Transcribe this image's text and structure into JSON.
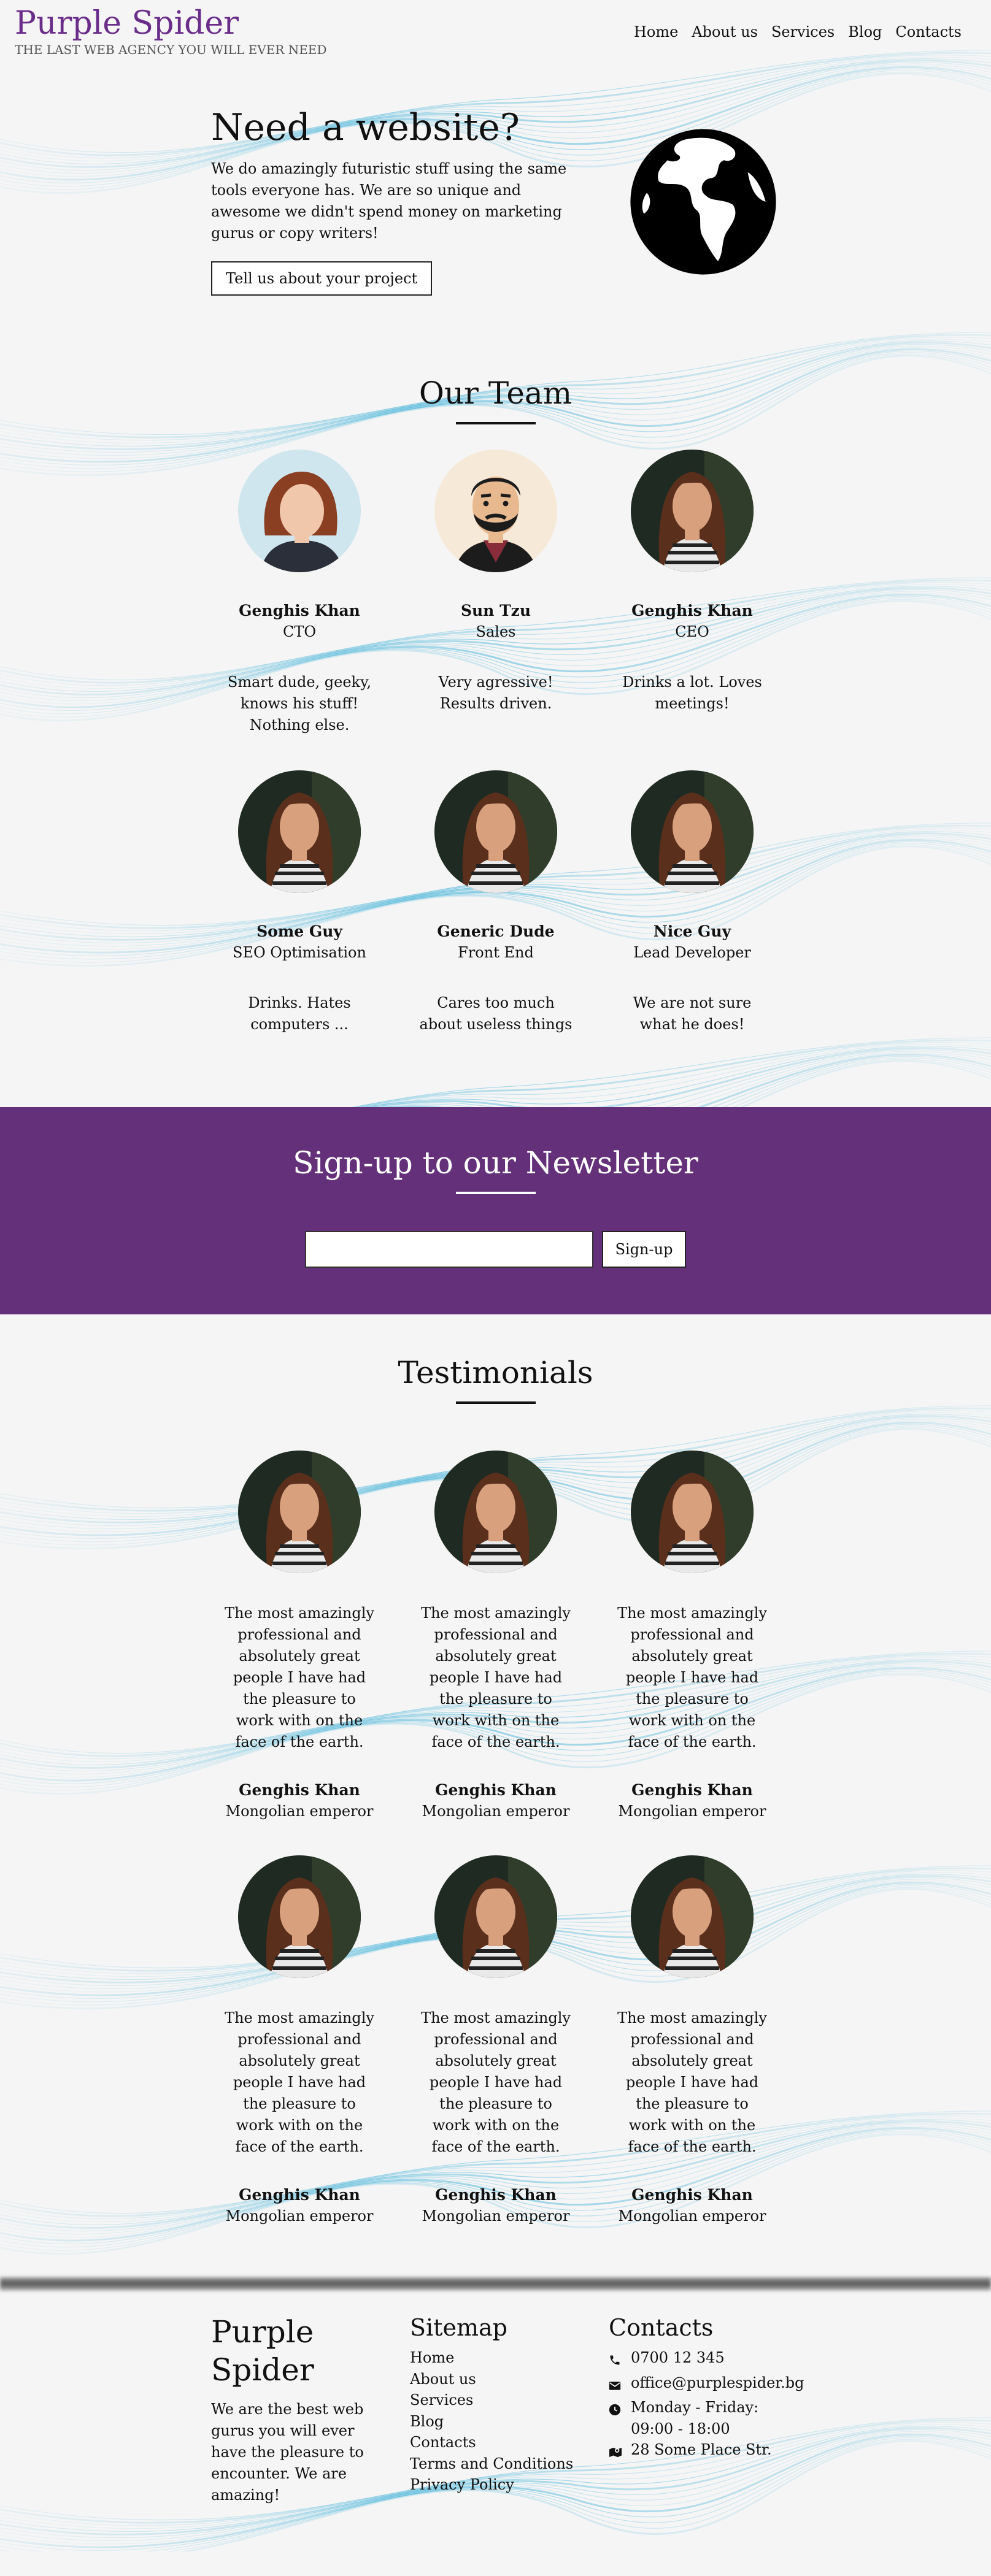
{
  "brand": {
    "name": "Purple Spider",
    "tagline": "THE LAST WEB AGENCY YOU WILL EVER NEED",
    "color": "#6b2d8a"
  },
  "nav": {
    "items": [
      "Home",
      "About us",
      "Services",
      "Blog",
      "Contacts"
    ]
  },
  "hero": {
    "title": "Need a website?",
    "description": "We do amazingly futuristic stuff using the same tools everyone has. We are so unique and awesome we didn't spend money on marketing gurus or copy writers!",
    "cta_label": "Tell us about your project",
    "icon": "globe-icon"
  },
  "team": {
    "title": "Our Team",
    "members": [
      {
        "name": "Genghis Khan",
        "role": "CTO",
        "desc": "Smart dude, geeky, knows his stuff! Nothing else.",
        "avatar": "photo-redhead"
      },
      {
        "name": "Sun Tzu",
        "role": "Sales",
        "desc": "Very agressive! Results driven.",
        "avatar": "illustrated-bearded-man"
      },
      {
        "name": "Genghis Khan",
        "role": "CEO",
        "desc": "Drinks a lot. Loves meetings!",
        "avatar": "photo-woman"
      },
      {
        "name": "Some Guy",
        "role": "SEO Optimisation",
        "desc": "Drinks. Hates computers ...",
        "avatar": "photo-woman"
      },
      {
        "name": "Generic Dude",
        "role": "Front End",
        "desc": "Cares too much about useless things",
        "avatar": "photo-woman"
      },
      {
        "name": "Nice Guy",
        "role": "Lead Developer",
        "desc": "We are not sure what he does!",
        "avatar": "photo-woman"
      }
    ]
  },
  "newsletter": {
    "title": "Sign-up to our Newsletter",
    "input_value": "",
    "button_label": "Sign-up",
    "bg_color": "#65307a"
  },
  "testimonials": {
    "title": "Testimonials",
    "items": [
      {
        "quote": "The most amazingly professional and absolutely great people I have had the pleasure to work with on the face of the earth.",
        "name": "Genghis Khan",
        "role": "Mongolian emperor"
      },
      {
        "quote": "The most amazingly professional and absolutely great people I have had the pleasure to work with on the face of the earth.",
        "name": "Genghis Khan",
        "role": "Mongolian emperor"
      },
      {
        "quote": "The most amazingly professional and absolutely great people I have had the pleasure to work with on the face of the earth.",
        "name": "Genghis Khan",
        "role": "Mongolian emperor"
      },
      {
        "quote": "The most amazingly professional and absolutely great people I have had the pleasure to work with on the face of the earth.",
        "name": "Genghis Khan",
        "role": "Mongolian emperor"
      },
      {
        "quote": "The most amazingly professional and absolutely great people I have had the pleasure to work with on the face of the earth.",
        "name": "Genghis Khan",
        "role": "Mongolian emperor"
      },
      {
        "quote": "The most amazingly professional and absolutely great people I have had the pleasure to work with on the face of the earth.",
        "name": "Genghis Khan",
        "role": "Mongolian emperor"
      }
    ]
  },
  "footer": {
    "brand": "Purple Spider",
    "about": "We are the best web gurus you will ever have the pleasure to encounter. We are amazing!",
    "sitemap_title": "Sitemap",
    "sitemap": [
      "Home",
      "About us",
      "Services",
      "Blog",
      "Contacts",
      "Terms and Conditions",
      "Privacy Policy"
    ],
    "contacts_title": "Contacts",
    "contacts": [
      {
        "icon": "phone-icon",
        "text": "0700 12 345"
      },
      {
        "icon": "envelope-icon",
        "text": "office@purplespider.bg"
      },
      {
        "icon": "clock-icon",
        "text": "Monday - Friday: 09:00 - 18:00"
      },
      {
        "icon": "map-icon",
        "text": "28 Some Place Str."
      }
    ]
  },
  "colors": {
    "wave": "#1ea5d3",
    "background": "#f5f5f5"
  }
}
